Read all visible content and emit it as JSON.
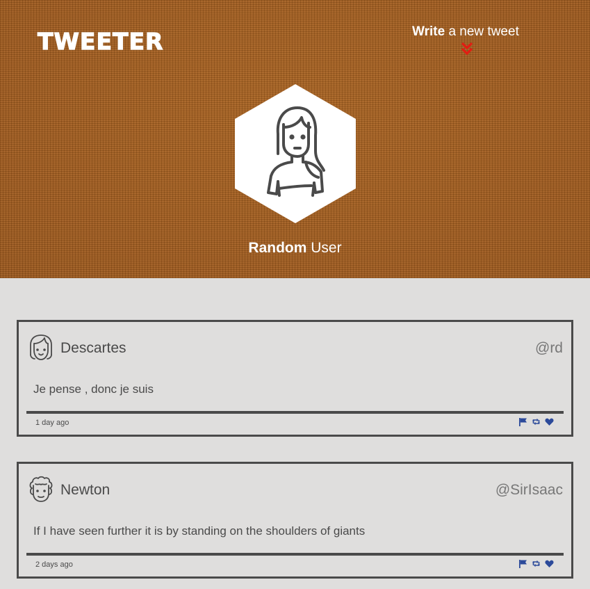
{
  "app": {
    "logo": "TWEETER"
  },
  "compose": {
    "bold": "Write",
    "rest": " a new tweet",
    "icon": "double-chevron-down-icon",
    "icon_color": "#e21d12"
  },
  "profile": {
    "first_name": "Random",
    "last_name": " User",
    "avatar_icon": "woman-avatar-icon"
  },
  "colors": {
    "header_brown": "#a25c1b",
    "page_background": "#dfdedd",
    "border": "#4a4a4a",
    "action_blue": "#2c4a9a"
  },
  "tweets": [
    {
      "author": "Descartes",
      "handle": "@rd",
      "text": "Je pense , donc je suis",
      "time": "1 day ago",
      "avatar_icon": "girl-avatar-icon",
      "actions": [
        "flag-icon",
        "retweet-icon",
        "heart-icon"
      ]
    },
    {
      "author": "Newton",
      "handle": "@SirIsaac",
      "text": "If I have seen further it is by standing on the shoulders of giants",
      "time": "2 days ago",
      "avatar_icon": "curly-hair-avatar-icon",
      "actions": [
        "flag-icon",
        "retweet-icon",
        "heart-icon"
      ]
    }
  ]
}
